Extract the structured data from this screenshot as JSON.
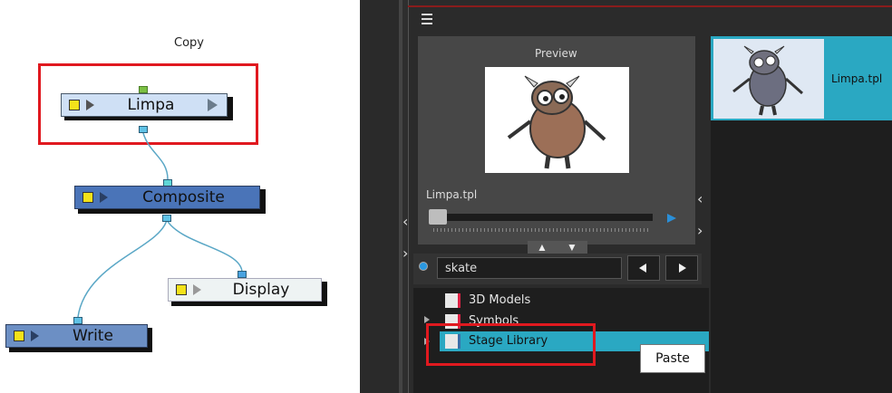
{
  "graph": {
    "copy_label": "Copy",
    "nodes": {
      "limpa": "Limpa",
      "composite": "Composite",
      "display": "Display",
      "write": "Write"
    }
  },
  "library": {
    "preview_title": "Preview",
    "preview_filename": "Limpa.tpl",
    "search_value": "skate",
    "tree": [
      "3D Models",
      "Symbols",
      "Stage Library"
    ],
    "thumbnail_label": "Limpa.tpl",
    "paste_label": "Paste"
  },
  "colors": {
    "highlight": "#e0191f",
    "selection": "#2aa8c2",
    "node_limpa": "#cfe0f5",
    "node_composite": "#4a74b8",
    "node_write": "#6c8fc4",
    "node_display": "#eef3f3"
  }
}
